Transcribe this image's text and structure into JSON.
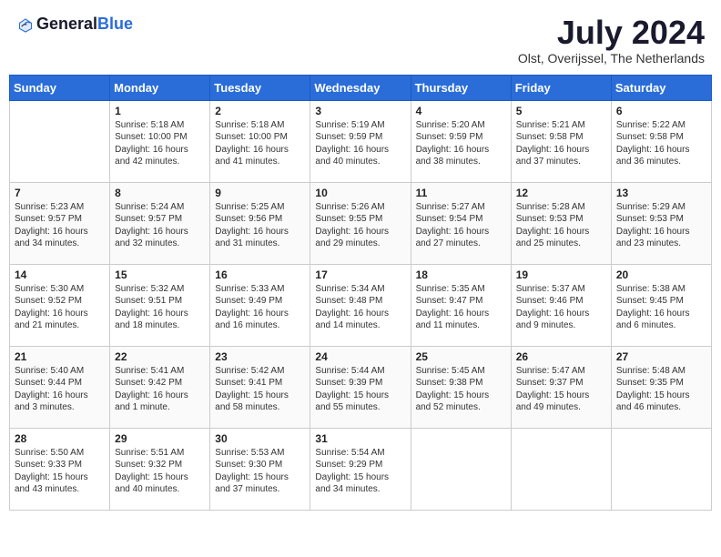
{
  "header": {
    "logo_general": "General",
    "logo_blue": "Blue",
    "month_year": "July 2024",
    "location": "Olst, Overijssel, The Netherlands"
  },
  "days_of_week": [
    "Sunday",
    "Monday",
    "Tuesday",
    "Wednesday",
    "Thursday",
    "Friday",
    "Saturday"
  ],
  "weeks": [
    [
      {
        "day": "",
        "content": ""
      },
      {
        "day": "1",
        "content": "Sunrise: 5:18 AM\nSunset: 10:00 PM\nDaylight: 16 hours\nand 42 minutes."
      },
      {
        "day": "2",
        "content": "Sunrise: 5:18 AM\nSunset: 10:00 PM\nDaylight: 16 hours\nand 41 minutes."
      },
      {
        "day": "3",
        "content": "Sunrise: 5:19 AM\nSunset: 9:59 PM\nDaylight: 16 hours\nand 40 minutes."
      },
      {
        "day": "4",
        "content": "Sunrise: 5:20 AM\nSunset: 9:59 PM\nDaylight: 16 hours\nand 38 minutes."
      },
      {
        "day": "5",
        "content": "Sunrise: 5:21 AM\nSunset: 9:58 PM\nDaylight: 16 hours\nand 37 minutes."
      },
      {
        "day": "6",
        "content": "Sunrise: 5:22 AM\nSunset: 9:58 PM\nDaylight: 16 hours\nand 36 minutes."
      }
    ],
    [
      {
        "day": "7",
        "content": "Sunrise: 5:23 AM\nSunset: 9:57 PM\nDaylight: 16 hours\nand 34 minutes."
      },
      {
        "day": "8",
        "content": "Sunrise: 5:24 AM\nSunset: 9:57 PM\nDaylight: 16 hours\nand 32 minutes."
      },
      {
        "day": "9",
        "content": "Sunrise: 5:25 AM\nSunset: 9:56 PM\nDaylight: 16 hours\nand 31 minutes."
      },
      {
        "day": "10",
        "content": "Sunrise: 5:26 AM\nSunset: 9:55 PM\nDaylight: 16 hours\nand 29 minutes."
      },
      {
        "day": "11",
        "content": "Sunrise: 5:27 AM\nSunset: 9:54 PM\nDaylight: 16 hours\nand 27 minutes."
      },
      {
        "day": "12",
        "content": "Sunrise: 5:28 AM\nSunset: 9:53 PM\nDaylight: 16 hours\nand 25 minutes."
      },
      {
        "day": "13",
        "content": "Sunrise: 5:29 AM\nSunset: 9:53 PM\nDaylight: 16 hours\nand 23 minutes."
      }
    ],
    [
      {
        "day": "14",
        "content": "Sunrise: 5:30 AM\nSunset: 9:52 PM\nDaylight: 16 hours\nand 21 minutes."
      },
      {
        "day": "15",
        "content": "Sunrise: 5:32 AM\nSunset: 9:51 PM\nDaylight: 16 hours\nand 18 minutes."
      },
      {
        "day": "16",
        "content": "Sunrise: 5:33 AM\nSunset: 9:49 PM\nDaylight: 16 hours\nand 16 minutes."
      },
      {
        "day": "17",
        "content": "Sunrise: 5:34 AM\nSunset: 9:48 PM\nDaylight: 16 hours\nand 14 minutes."
      },
      {
        "day": "18",
        "content": "Sunrise: 5:35 AM\nSunset: 9:47 PM\nDaylight: 16 hours\nand 11 minutes."
      },
      {
        "day": "19",
        "content": "Sunrise: 5:37 AM\nSunset: 9:46 PM\nDaylight: 16 hours\nand 9 minutes."
      },
      {
        "day": "20",
        "content": "Sunrise: 5:38 AM\nSunset: 9:45 PM\nDaylight: 16 hours\nand 6 minutes."
      }
    ],
    [
      {
        "day": "21",
        "content": "Sunrise: 5:40 AM\nSunset: 9:44 PM\nDaylight: 16 hours\nand 3 minutes."
      },
      {
        "day": "22",
        "content": "Sunrise: 5:41 AM\nSunset: 9:42 PM\nDaylight: 16 hours\nand 1 minute."
      },
      {
        "day": "23",
        "content": "Sunrise: 5:42 AM\nSunset: 9:41 PM\nDaylight: 15 hours\nand 58 minutes."
      },
      {
        "day": "24",
        "content": "Sunrise: 5:44 AM\nSunset: 9:39 PM\nDaylight: 15 hours\nand 55 minutes."
      },
      {
        "day": "25",
        "content": "Sunrise: 5:45 AM\nSunset: 9:38 PM\nDaylight: 15 hours\nand 52 minutes."
      },
      {
        "day": "26",
        "content": "Sunrise: 5:47 AM\nSunset: 9:37 PM\nDaylight: 15 hours\nand 49 minutes."
      },
      {
        "day": "27",
        "content": "Sunrise: 5:48 AM\nSunset: 9:35 PM\nDaylight: 15 hours\nand 46 minutes."
      }
    ],
    [
      {
        "day": "28",
        "content": "Sunrise: 5:50 AM\nSunset: 9:33 PM\nDaylight: 15 hours\nand 43 minutes."
      },
      {
        "day": "29",
        "content": "Sunrise: 5:51 AM\nSunset: 9:32 PM\nDaylight: 15 hours\nand 40 minutes."
      },
      {
        "day": "30",
        "content": "Sunrise: 5:53 AM\nSunset: 9:30 PM\nDaylight: 15 hours\nand 37 minutes."
      },
      {
        "day": "31",
        "content": "Sunrise: 5:54 AM\nSunset: 9:29 PM\nDaylight: 15 hours\nand 34 minutes."
      },
      {
        "day": "",
        "content": ""
      },
      {
        "day": "",
        "content": ""
      },
      {
        "day": "",
        "content": ""
      }
    ]
  ]
}
